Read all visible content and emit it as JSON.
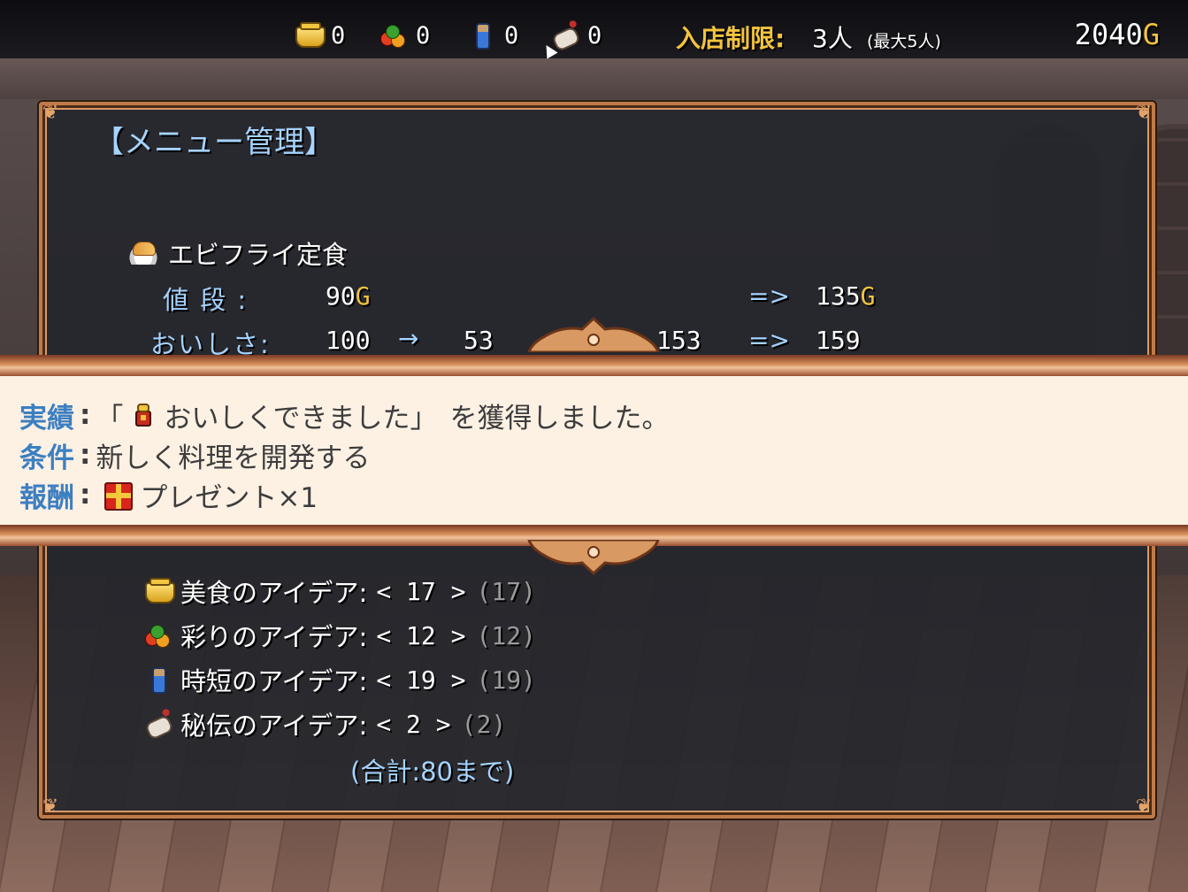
{
  "hud": {
    "resources": [
      {
        "icon": "pot-icon",
        "value": "0"
      },
      {
        "icon": "vegetables-icon",
        "value": "0"
      },
      {
        "icon": "bottle-icon",
        "value": "0"
      },
      {
        "icon": "scroll-icon",
        "value": "0"
      }
    ],
    "limit_label": "入店制限:",
    "limit_value": "3人",
    "limit_max": "(最大5人)",
    "gold": "2040",
    "gold_unit": "G"
  },
  "menu": {
    "title": "【メニュー管理】",
    "dish_name": "エビフライ定食",
    "price_label": "値 段 :",
    "price_value": "90",
    "price_unit": "G",
    "price_arrow": "=>",
    "price_new": "135",
    "price_new_unit": "G",
    "taste_label": "おいしさ:",
    "taste_base": "100",
    "taste_arrow": "→",
    "taste_mid": "53",
    "taste_hidden": "+",
    "taste_total": "153",
    "taste_arrow2": "=>",
    "taste_new": "159",
    "ideas": [
      {
        "icon": "pot-icon",
        "label": "美食のアイデア:",
        "value": "< 17 >",
        "max": "(17)"
      },
      {
        "icon": "vegetables-icon",
        "label": "彩りのアイデア:",
        "value": "< 12 >",
        "max": "(12)"
      },
      {
        "icon": "bottle-icon",
        "label": "時短のアイデア:",
        "value": "< 19 >",
        "max": "(19)"
      },
      {
        "icon": "scroll-icon",
        "label": "秘伝のアイデア:",
        "value": "< 2 >",
        "max": "(2)"
      }
    ],
    "total": "(合計:80まで)"
  },
  "notification": {
    "achievement_key": "実績",
    "achievement_open": "「",
    "achievement_name": "おいしくできました」",
    "achievement_suffix": "を獲得しました。",
    "condition_key": "条件",
    "condition_value": "新しく料理を開発する",
    "reward_key": "報酬",
    "reward_value": "プレゼント×1"
  },
  "colors": {
    "accent_blue": "#a5d3ff",
    "gold": "#f2c33d",
    "frame": "#c07a48",
    "banner_bg": "#fdf1e4",
    "banner_key": "#3d7fc1"
  }
}
